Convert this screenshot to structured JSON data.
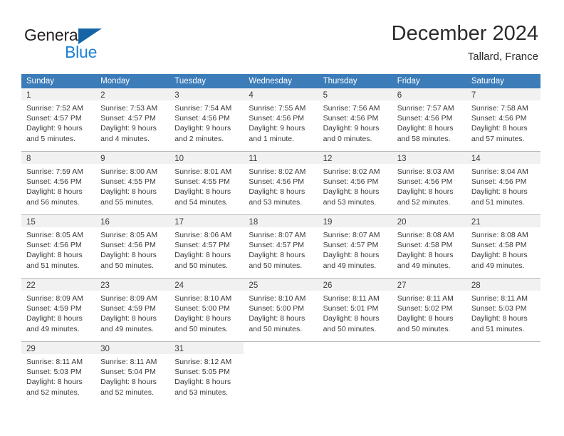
{
  "brand": {
    "name_part1": "General",
    "name_part2": "Blue"
  },
  "header": {
    "title": "December 2024",
    "subtitle": "Tallard, France"
  },
  "colors": {
    "header_blue": "#3b7cb9",
    "logo_blue": "#1b7fd4",
    "logo_triangle": "#1565a6",
    "day_band_gray": "#f1f1f1",
    "row_border": "#b9b9b9"
  },
  "weekdays": [
    "Sunday",
    "Monday",
    "Tuesday",
    "Wednesday",
    "Thursday",
    "Friday",
    "Saturday"
  ],
  "weeks": [
    [
      {
        "day": "1",
        "sunrise": "Sunrise: 7:52 AM",
        "sunset": "Sunset: 4:57 PM",
        "daylight1": "Daylight: 9 hours",
        "daylight2": "and 5 minutes."
      },
      {
        "day": "2",
        "sunrise": "Sunrise: 7:53 AM",
        "sunset": "Sunset: 4:57 PM",
        "daylight1": "Daylight: 9 hours",
        "daylight2": "and 4 minutes."
      },
      {
        "day": "3",
        "sunrise": "Sunrise: 7:54 AM",
        "sunset": "Sunset: 4:56 PM",
        "daylight1": "Daylight: 9 hours",
        "daylight2": "and 2 minutes."
      },
      {
        "day": "4",
        "sunrise": "Sunrise: 7:55 AM",
        "sunset": "Sunset: 4:56 PM",
        "daylight1": "Daylight: 9 hours",
        "daylight2": "and 1 minute."
      },
      {
        "day": "5",
        "sunrise": "Sunrise: 7:56 AM",
        "sunset": "Sunset: 4:56 PM",
        "daylight1": "Daylight: 9 hours",
        "daylight2": "and 0 minutes."
      },
      {
        "day": "6",
        "sunrise": "Sunrise: 7:57 AM",
        "sunset": "Sunset: 4:56 PM",
        "daylight1": "Daylight: 8 hours",
        "daylight2": "and 58 minutes."
      },
      {
        "day": "7",
        "sunrise": "Sunrise: 7:58 AM",
        "sunset": "Sunset: 4:56 PM",
        "daylight1": "Daylight: 8 hours",
        "daylight2": "and 57 minutes."
      }
    ],
    [
      {
        "day": "8",
        "sunrise": "Sunrise: 7:59 AM",
        "sunset": "Sunset: 4:56 PM",
        "daylight1": "Daylight: 8 hours",
        "daylight2": "and 56 minutes."
      },
      {
        "day": "9",
        "sunrise": "Sunrise: 8:00 AM",
        "sunset": "Sunset: 4:55 PM",
        "daylight1": "Daylight: 8 hours",
        "daylight2": "and 55 minutes."
      },
      {
        "day": "10",
        "sunrise": "Sunrise: 8:01 AM",
        "sunset": "Sunset: 4:55 PM",
        "daylight1": "Daylight: 8 hours",
        "daylight2": "and 54 minutes."
      },
      {
        "day": "11",
        "sunrise": "Sunrise: 8:02 AM",
        "sunset": "Sunset: 4:56 PM",
        "daylight1": "Daylight: 8 hours",
        "daylight2": "and 53 minutes."
      },
      {
        "day": "12",
        "sunrise": "Sunrise: 8:02 AM",
        "sunset": "Sunset: 4:56 PM",
        "daylight1": "Daylight: 8 hours",
        "daylight2": "and 53 minutes."
      },
      {
        "day": "13",
        "sunrise": "Sunrise: 8:03 AM",
        "sunset": "Sunset: 4:56 PM",
        "daylight1": "Daylight: 8 hours",
        "daylight2": "and 52 minutes."
      },
      {
        "day": "14",
        "sunrise": "Sunrise: 8:04 AM",
        "sunset": "Sunset: 4:56 PM",
        "daylight1": "Daylight: 8 hours",
        "daylight2": "and 51 minutes."
      }
    ],
    [
      {
        "day": "15",
        "sunrise": "Sunrise: 8:05 AM",
        "sunset": "Sunset: 4:56 PM",
        "daylight1": "Daylight: 8 hours",
        "daylight2": "and 51 minutes."
      },
      {
        "day": "16",
        "sunrise": "Sunrise: 8:05 AM",
        "sunset": "Sunset: 4:56 PM",
        "daylight1": "Daylight: 8 hours",
        "daylight2": "and 50 minutes."
      },
      {
        "day": "17",
        "sunrise": "Sunrise: 8:06 AM",
        "sunset": "Sunset: 4:57 PM",
        "daylight1": "Daylight: 8 hours",
        "daylight2": "and 50 minutes."
      },
      {
        "day": "18",
        "sunrise": "Sunrise: 8:07 AM",
        "sunset": "Sunset: 4:57 PM",
        "daylight1": "Daylight: 8 hours",
        "daylight2": "and 50 minutes."
      },
      {
        "day": "19",
        "sunrise": "Sunrise: 8:07 AM",
        "sunset": "Sunset: 4:57 PM",
        "daylight1": "Daylight: 8 hours",
        "daylight2": "and 49 minutes."
      },
      {
        "day": "20",
        "sunrise": "Sunrise: 8:08 AM",
        "sunset": "Sunset: 4:58 PM",
        "daylight1": "Daylight: 8 hours",
        "daylight2": "and 49 minutes."
      },
      {
        "day": "21",
        "sunrise": "Sunrise: 8:08 AM",
        "sunset": "Sunset: 4:58 PM",
        "daylight1": "Daylight: 8 hours",
        "daylight2": "and 49 minutes."
      }
    ],
    [
      {
        "day": "22",
        "sunrise": "Sunrise: 8:09 AM",
        "sunset": "Sunset: 4:59 PM",
        "daylight1": "Daylight: 8 hours",
        "daylight2": "and 49 minutes."
      },
      {
        "day": "23",
        "sunrise": "Sunrise: 8:09 AM",
        "sunset": "Sunset: 4:59 PM",
        "daylight1": "Daylight: 8 hours",
        "daylight2": "and 49 minutes."
      },
      {
        "day": "24",
        "sunrise": "Sunrise: 8:10 AM",
        "sunset": "Sunset: 5:00 PM",
        "daylight1": "Daylight: 8 hours",
        "daylight2": "and 50 minutes."
      },
      {
        "day": "25",
        "sunrise": "Sunrise: 8:10 AM",
        "sunset": "Sunset: 5:00 PM",
        "daylight1": "Daylight: 8 hours",
        "daylight2": "and 50 minutes."
      },
      {
        "day": "26",
        "sunrise": "Sunrise: 8:11 AM",
        "sunset": "Sunset: 5:01 PM",
        "daylight1": "Daylight: 8 hours",
        "daylight2": "and 50 minutes."
      },
      {
        "day": "27",
        "sunrise": "Sunrise: 8:11 AM",
        "sunset": "Sunset: 5:02 PM",
        "daylight1": "Daylight: 8 hours",
        "daylight2": "and 50 minutes."
      },
      {
        "day": "28",
        "sunrise": "Sunrise: 8:11 AM",
        "sunset": "Sunset: 5:03 PM",
        "daylight1": "Daylight: 8 hours",
        "daylight2": "and 51 minutes."
      }
    ],
    [
      {
        "day": "29",
        "sunrise": "Sunrise: 8:11 AM",
        "sunset": "Sunset: 5:03 PM",
        "daylight1": "Daylight: 8 hours",
        "daylight2": "and 52 minutes."
      },
      {
        "day": "30",
        "sunrise": "Sunrise: 8:11 AM",
        "sunset": "Sunset: 5:04 PM",
        "daylight1": "Daylight: 8 hours",
        "daylight2": "and 52 minutes."
      },
      {
        "day": "31",
        "sunrise": "Sunrise: 8:12 AM",
        "sunset": "Sunset: 5:05 PM",
        "daylight1": "Daylight: 8 hours",
        "daylight2": "and 53 minutes."
      },
      {
        "day": "",
        "sunrise": "",
        "sunset": "",
        "daylight1": "",
        "daylight2": ""
      },
      {
        "day": "",
        "sunrise": "",
        "sunset": "",
        "daylight1": "",
        "daylight2": ""
      },
      {
        "day": "",
        "sunrise": "",
        "sunset": "",
        "daylight1": "",
        "daylight2": ""
      },
      {
        "day": "",
        "sunrise": "",
        "sunset": "",
        "daylight1": "",
        "daylight2": ""
      }
    ]
  ]
}
